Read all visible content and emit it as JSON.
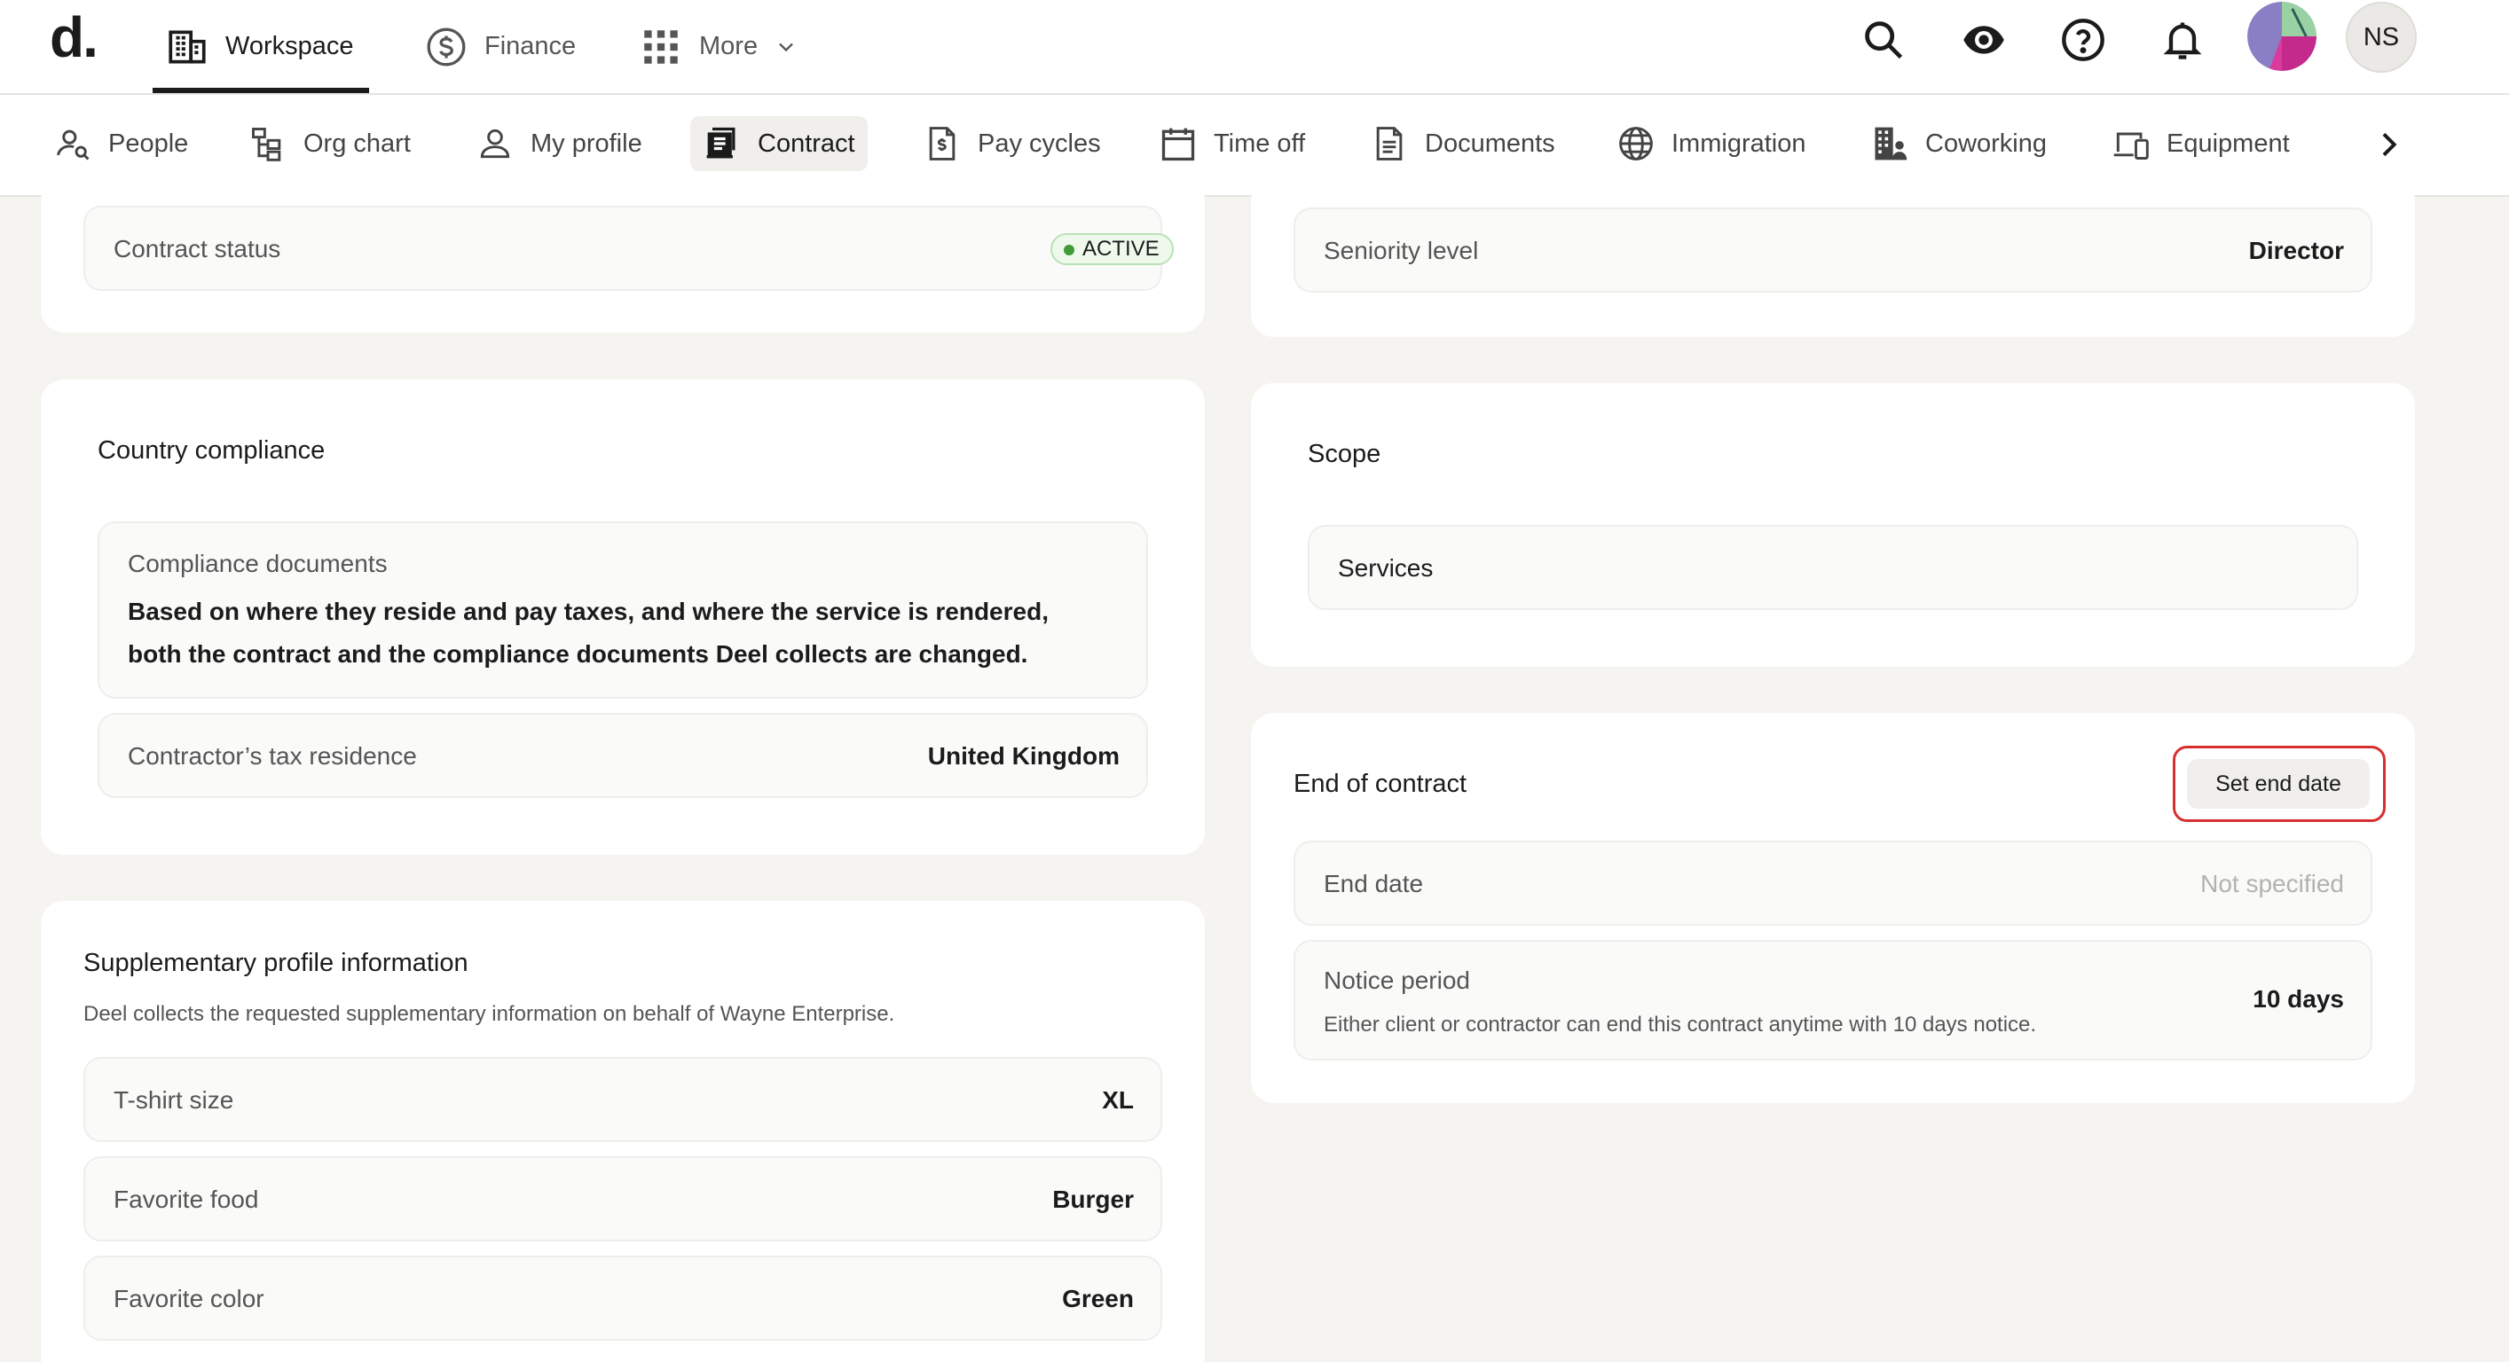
{
  "topbar": {
    "logo": "d",
    "nav": [
      {
        "label": "Workspace",
        "icon": "building-icon",
        "active": true
      },
      {
        "label": "Finance",
        "icon": "dollar-circle-icon",
        "active": false
      },
      {
        "label": "More",
        "icon": "grid-icon",
        "active": false
      }
    ],
    "actions": [
      "search-icon",
      "eye-icon",
      "help-circle-icon",
      "bell-icon"
    ],
    "user_initials": "NS"
  },
  "subnav": {
    "items": [
      {
        "label": "People",
        "icon": "people-search-icon"
      },
      {
        "label": "Org chart",
        "icon": "org-chart-icon"
      },
      {
        "label": "My profile",
        "icon": "user-icon"
      },
      {
        "label": "Contract",
        "icon": "contract-icon",
        "active": true
      },
      {
        "label": "Pay cycles",
        "icon": "pay-doc-icon"
      },
      {
        "label": "Time off",
        "icon": "calendar-icon"
      },
      {
        "label": "Documents",
        "icon": "document-icon"
      },
      {
        "label": "Immigration",
        "icon": "globe-icon"
      },
      {
        "label": "Coworking",
        "icon": "office-icon"
      },
      {
        "label": "Equipment",
        "icon": "devices-icon"
      }
    ]
  },
  "contract_status": {
    "label": "Contract status",
    "value": "ACTIVE",
    "status_color": "#3f9a3a"
  },
  "seniority": {
    "label": "Seniority level",
    "value": "Director"
  },
  "country_compliance": {
    "title": "Country compliance",
    "docs_label": "Compliance documents",
    "docs_line1": "Based on where they reside and pay taxes, and where the service is rendered,",
    "docs_line2": "both the contract and the compliance documents Deel collects are changed.",
    "tax_label": "Contractor’s tax residence",
    "tax_value": "United Kingdom"
  },
  "scope": {
    "title": "Scope",
    "services": "Services"
  },
  "end_of_contract": {
    "title": "End of contract",
    "button": "Set end date",
    "end_date_label": "End date",
    "end_date_value": "Not specified",
    "notice_label": "Notice period",
    "notice_desc": "Either client or contractor can end this contract anytime with 10 days notice.",
    "notice_value": "10 days"
  },
  "supplementary": {
    "title": "Supplementary profile information",
    "subtitle": "Deel collects the requested supplementary information on behalf of Wayne Enterprise.",
    "rows": [
      {
        "label": "T-shirt size",
        "value": "XL"
      },
      {
        "label": "Favorite food",
        "value": "Burger"
      },
      {
        "label": "Favorite color",
        "value": "Green"
      }
    ]
  }
}
